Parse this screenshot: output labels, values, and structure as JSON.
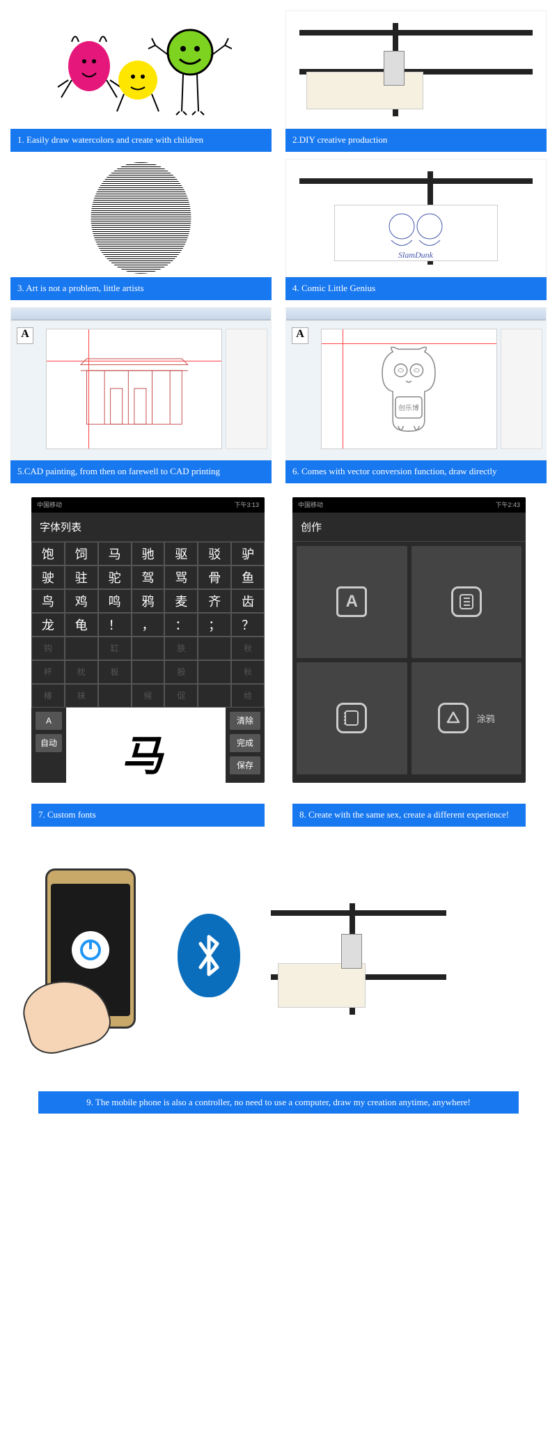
{
  "captions": {
    "c1": "1. Easily draw watercolors and create with children",
    "c2": "2.DIY creative production",
    "c3": "3. Art is not a problem, little artists",
    "c4": "4. Comic Little Genius",
    "c5": "5.CAD painting, from then on farewell to CAD printing",
    "c6": "6. Comes with vector conversion function, draw directly",
    "c7": "7. Custom fonts",
    "c8": "8. Create with the same sex, create a different experience!",
    "c9": "9. The mobile phone is also a controller, no need to use a computer, draw my creation anytime, anywhere!"
  },
  "phone1": {
    "carrier": "中国移动",
    "time": "下午3:13",
    "header": "字体列表",
    "chars_row1": [
      "饱",
      "饲",
      "马",
      "驰",
      "驱",
      "驳",
      "驴"
    ],
    "chars_row2": [
      "驶",
      "驻",
      "驼",
      "驾",
      "骂",
      "骨",
      "鱼"
    ],
    "chars_row3": [
      "鸟",
      "鸡",
      "鸣",
      "鸦",
      "麦",
      "齐",
      "齿"
    ],
    "chars_row4": [
      "龙",
      "龟",
      "！",
      "，",
      "：",
      "；",
      "？"
    ],
    "chars_dim1": [
      "钩",
      "",
      "缸",
      "",
      "肤",
      "",
      "秋"
    ],
    "chars_dim2": [
      "杯",
      "枕",
      "板",
      "",
      "股",
      "",
      "秋"
    ],
    "chars_dim3": [
      "椿",
      "袜",
      "",
      "候",
      "促",
      "",
      "给"
    ],
    "btn_a": "A",
    "btn_auto": "自动",
    "handwritten": "马",
    "btn_clear": "清除",
    "btn_done": "完成",
    "btn_save": "保存"
  },
  "phone2": {
    "carrier": "中国移动",
    "time": "下午2:43",
    "header": "创作",
    "cell1_icon": "A",
    "cell4_label": "涂鸦"
  },
  "colors": {
    "caption_bg": "#1878f0",
    "bluetooth": "#0a6ebd"
  }
}
